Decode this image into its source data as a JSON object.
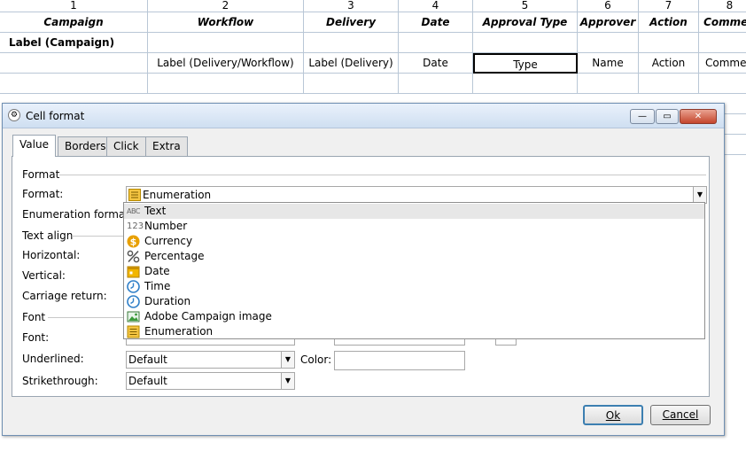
{
  "sheet": {
    "col_numbers": [
      "1",
      "2",
      "3",
      "4",
      "5",
      "6",
      "7",
      "8"
    ],
    "headers": [
      "Campaign",
      "Workflow",
      "Delivery",
      "Date",
      "Approval Type",
      "Approver",
      "Action",
      "Commen"
    ],
    "row1": {
      "campaign": "Label (Campaign)"
    },
    "row2": {
      "workflow": "Label (Delivery/Workflow)",
      "delivery": "Label (Delivery)",
      "date": "Date",
      "type": "Type",
      "approver": "Name",
      "action": "Action",
      "comment": "Commer"
    }
  },
  "dialog": {
    "title": "Cell format",
    "buttons": {
      "minimize": "—",
      "maximize": "▭",
      "close": "✕"
    },
    "tabs": [
      "Value",
      "Borders",
      "Click",
      "Extra"
    ],
    "sections": {
      "format": "Format",
      "text_align": "Text align",
      "font": "Font"
    },
    "labels": {
      "format": "Format:",
      "enumeration_format": "Enumeration format:",
      "horizontal": "Horizontal:",
      "vertical": "Vertical:",
      "carriage_return": "Carriage return:",
      "font": "Font:",
      "underlined": "Underlined:",
      "strikethrough": "Strikethrough:",
      "color": "Color:"
    },
    "format_value": "Enumeration",
    "underlined_value": "Default",
    "strikethrough_value": "Default",
    "ok": "Ok",
    "cancel": "Cancel"
  },
  "dropdown": {
    "items": [
      {
        "label": "Text",
        "icon": "abc-text-icon"
      },
      {
        "label": "Number",
        "icon": "number-123-icon"
      },
      {
        "label": "Currency",
        "icon": "currency-icon"
      },
      {
        "label": "Percentage",
        "icon": "percent-icon"
      },
      {
        "label": "Date",
        "icon": "calendar-icon"
      },
      {
        "label": "Time",
        "icon": "clock-icon"
      },
      {
        "label": "Duration",
        "icon": "duration-clock-icon"
      },
      {
        "label": "Adobe Campaign image",
        "icon": "image-icon"
      },
      {
        "label": "Enumeration",
        "icon": "enumeration-icon"
      }
    ],
    "abc": "ABC",
    "num": "123"
  },
  "colors": {
    "gold": "#e8a000",
    "blue": "#2f7fc8",
    "green": "#3a9a3a"
  }
}
